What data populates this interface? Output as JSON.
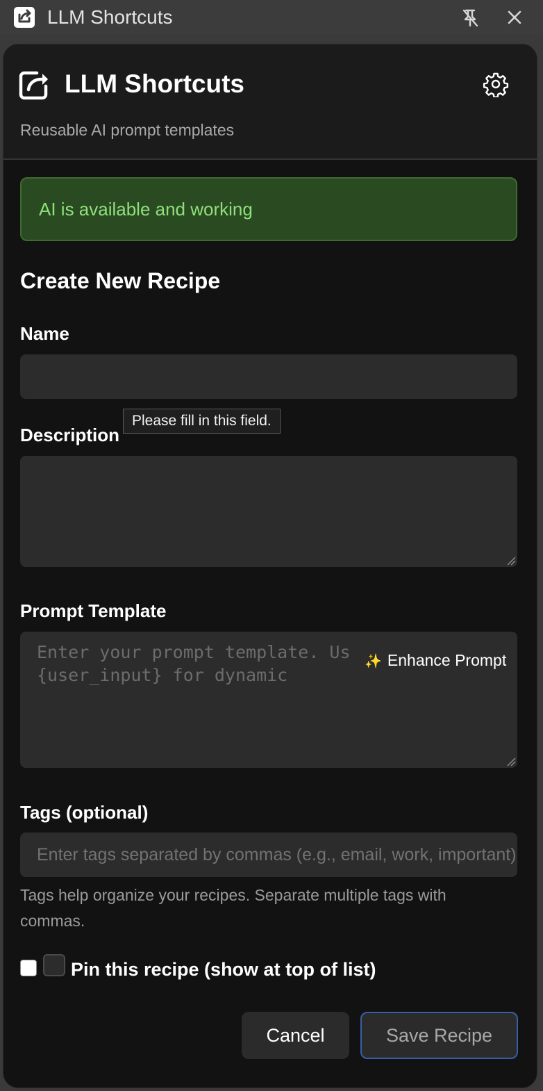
{
  "window": {
    "title": "LLM Shortcuts",
    "icons": {
      "app": "share-box-icon",
      "unpin": "unpin-icon",
      "close": "close-icon"
    }
  },
  "header": {
    "title": "LLM Shortcuts",
    "subtitle": "Reusable AI prompt templates",
    "icons": {
      "app": "share-box-icon",
      "settings": "gear-icon"
    }
  },
  "status": {
    "message": "AI is available and working",
    "colors": {
      "background": "#2a4a21",
      "border": "#3f6a31",
      "text": "#8fe07d"
    }
  },
  "form": {
    "title": "Create New Recipe",
    "name": {
      "label": "Name",
      "value": ""
    },
    "validation_tooltip": "Please fill in this field.",
    "description": {
      "label": "Description",
      "value": ""
    },
    "prompt": {
      "label": "Prompt Template",
      "placeholder": "Enter your prompt template. Use {user_input} for dynamic content.",
      "enhance_label": "Enhance Prompt",
      "enhance_icon": "sparkles-icon"
    },
    "tags": {
      "label": "Tags (optional)",
      "placeholder": "Enter tags separated by commas (e.g., email, work, important)",
      "help": "Tags help organize your recipes. Separate multiple tags with commas."
    },
    "pin": {
      "label": "Pin this recipe (show at top of list)",
      "checked": false
    },
    "buttons": {
      "cancel": "Cancel",
      "save": "Save Recipe"
    }
  },
  "colors": {
    "accent_border": "#3b5da6",
    "panel_bg": "#121212",
    "field_bg": "#2c2c2c"
  }
}
